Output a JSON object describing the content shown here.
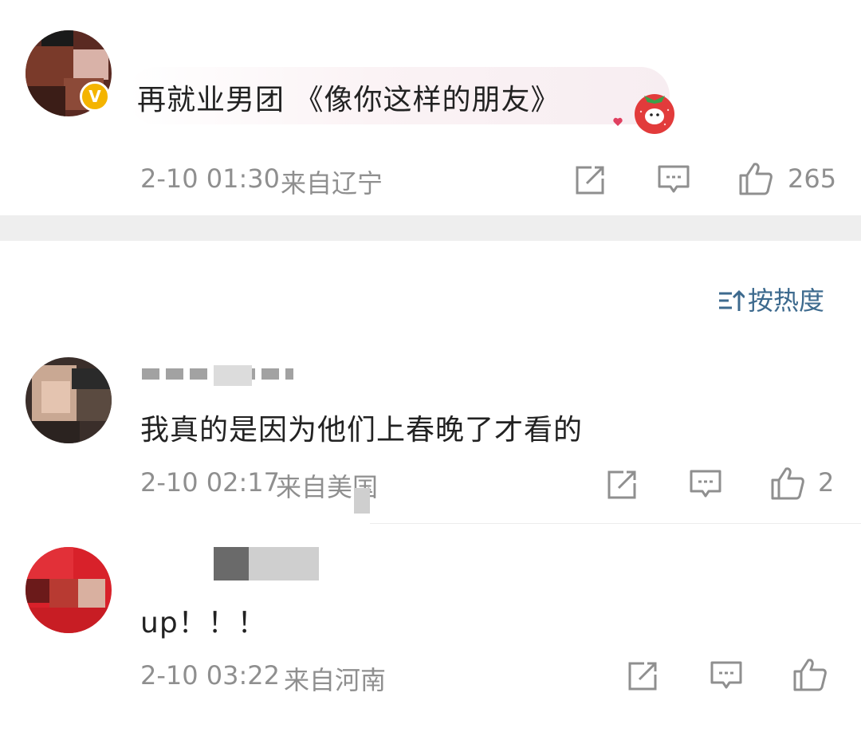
{
  "comments": [
    {
      "content": "再就业男团 《像你这样的朋友》",
      "date": "2-10 01:30",
      "location": "来自辽宁",
      "likes": "265",
      "verified_badge": "V"
    },
    {
      "content": "我真的是因为他们上春晚了才看的",
      "date": "2-10 02:17",
      "location": "来自美国",
      "likes": "2"
    },
    {
      "content": "up！！！",
      "date": "2-10 03:22",
      "location": "来自河南",
      "likes": ""
    }
  ],
  "sort": {
    "label": "按热度",
    "icon": "sort-icon"
  },
  "icons": [
    "share-icon",
    "comment-icon",
    "like-icon",
    "strawberry-sticker-icon",
    "heart-icon"
  ],
  "colors": {
    "meta_text": "#8f8f8f",
    "sort_text": "#3d6a8e",
    "verified_badge": "#f4b400",
    "band": "#eeeeee"
  }
}
